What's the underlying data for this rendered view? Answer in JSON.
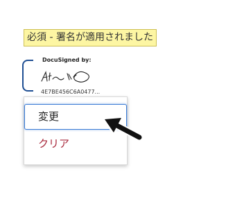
{
  "banner": {
    "text": "必須 - 署名が適用されました"
  },
  "signature": {
    "header": "DocuSigned by:",
    "id": "4E7BE456C6A0477...",
    "bracket_color": "#1f4f93"
  },
  "menu": {
    "items": [
      {
        "label": "変更",
        "color": "#222222"
      },
      {
        "label": "クリア",
        "color": "#a8283c"
      }
    ]
  },
  "icons": {
    "cursor": "pointer-arrow-icon",
    "signature": "handwritten-signature-icon"
  }
}
